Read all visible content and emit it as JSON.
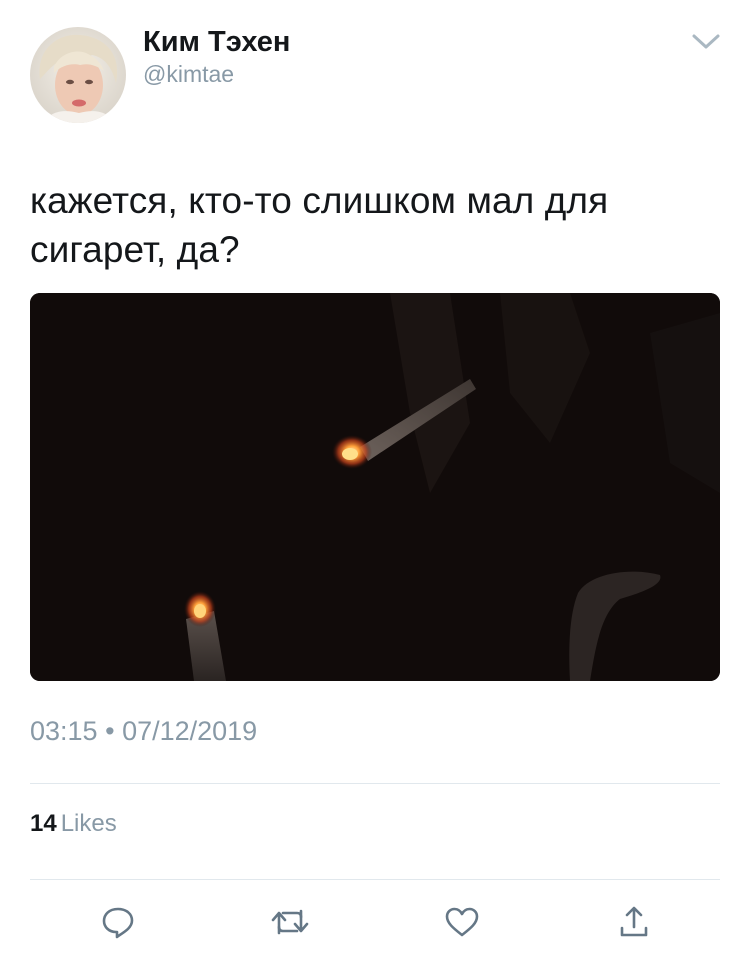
{
  "user": {
    "name": "Ким Тэхен",
    "handle": "@kimtae"
  },
  "tweet": {
    "text": "кажется, кто-то слишком мал для сигарет, да?",
    "time": "03:15",
    "separator": "•",
    "date": "07/12/2019"
  },
  "stats": {
    "likes_count": "14",
    "likes_label": "Likes"
  },
  "actions": {
    "reply_icon": "reply-bubble-icon",
    "retweet_icon": "retweet-arrows-icon",
    "like_icon": "heart-icon",
    "share_icon": "share-upload-icon"
  },
  "colors": {
    "text": "#14171a",
    "secondary": "#8899a6",
    "divider": "#e1e8ed",
    "icon": "#657786"
  }
}
